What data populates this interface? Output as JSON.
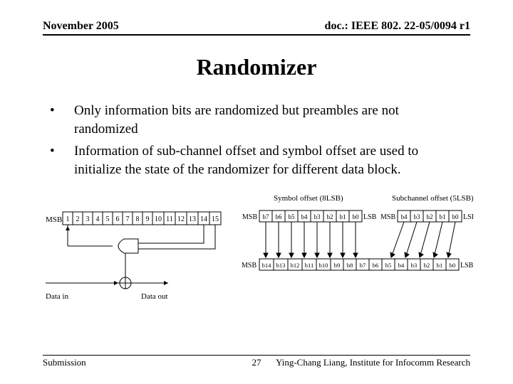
{
  "header": {
    "left": "November 2005",
    "right": "doc.: IEEE 802. 22-05/0094 r1"
  },
  "title": "Randomizer",
  "bullets": [
    "Only information bits are randomized but preambles are not randomized",
    "Information of  sub-channel offset and symbol offset are used to initialize the state of the randomizer for different data block."
  ],
  "diagram": {
    "msb_label": "MSB",
    "lsb_label": "LSB",
    "shift_cells": [
      "1",
      "2",
      "3",
      "4",
      "5",
      "6",
      "7",
      "8",
      "9",
      "10",
      "11",
      "12",
      "13",
      "14",
      "15"
    ],
    "data_in": "Data in",
    "data_out": "Data out",
    "symbol_offset": "Symbol offset (8LSB)",
    "subchannel_offset": "Subchannel offset (5LSB)",
    "top_bits": [
      "b7",
      "b6",
      "b5",
      "b4",
      "b3",
      "b2",
      "b1",
      "b0"
    ],
    "top_bits2": [
      "b4",
      "b3",
      "b2",
      "b1",
      "b0"
    ],
    "bottom_bits": [
      "b14",
      "b13",
      "b12",
      "b11",
      "b10",
      "b9",
      "b8",
      "b7",
      "b6",
      "b5",
      "b4",
      "b3",
      "b2",
      "b1",
      "b0"
    ]
  },
  "footer": {
    "left": "Submission",
    "center": "27",
    "right": "Ying-Chang Liang, Institute for Infocomm Research"
  }
}
